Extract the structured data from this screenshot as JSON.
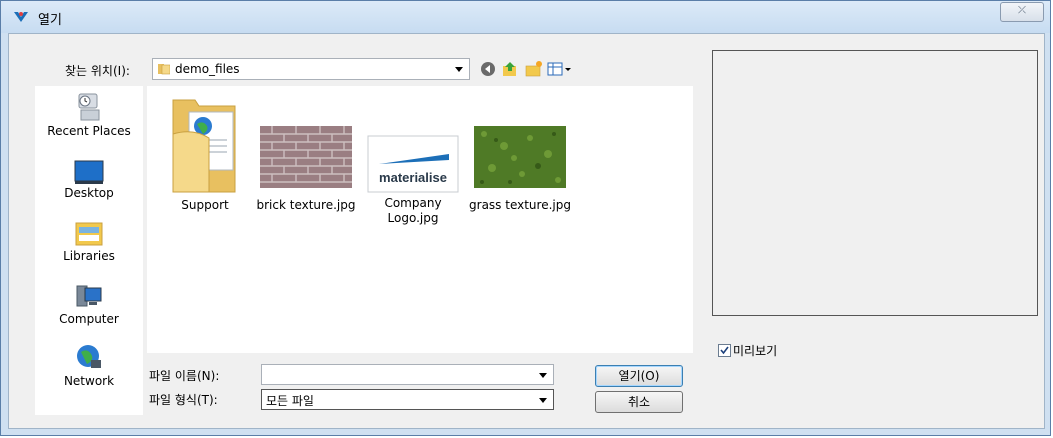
{
  "window": {
    "title": "열기",
    "close_glyph": "⤫"
  },
  "lookin": {
    "label": "찾는 위치(I):",
    "value": "demo_files"
  },
  "toolbar": {
    "icons": [
      "back-icon",
      "up-folder-icon",
      "new-folder-icon",
      "view-menu-icon"
    ]
  },
  "places": [
    {
      "label": "Recent Places",
      "icon": "recent-places-icon"
    },
    {
      "label": "Desktop",
      "icon": "desktop-icon"
    },
    {
      "label": "Libraries",
      "icon": "libraries-icon"
    },
    {
      "label": "Computer",
      "icon": "computer-icon"
    },
    {
      "label": "Network",
      "icon": "network-icon"
    }
  ],
  "files": [
    {
      "name": "Support",
      "kind": "folder"
    },
    {
      "name": "brick texture.jpg",
      "kind": "image"
    },
    {
      "name": "Company Logo.jpg",
      "kind": "image",
      "logo_text": "materialise"
    },
    {
      "name": "grass texture.jpg",
      "kind": "image"
    }
  ],
  "preview": {
    "label": "미리보기",
    "checked": true
  },
  "filename": {
    "label": "파일 이름(N):",
    "value": ""
  },
  "filetype": {
    "label": "파일 형식(T):",
    "value": "모든 파일"
  },
  "buttons": {
    "open": "열기(O)",
    "cancel": "취소"
  },
  "colors": {
    "accent": "#1c6fb8",
    "title_bg": "#cfe0f1"
  }
}
